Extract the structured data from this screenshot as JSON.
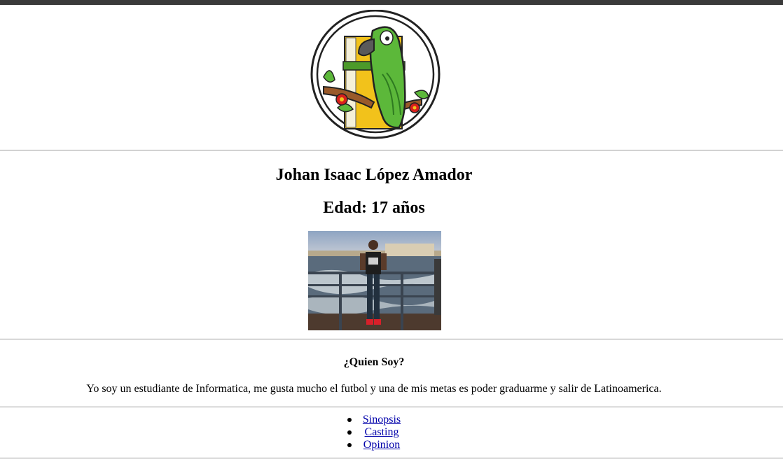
{
  "profile": {
    "name": "Johan Isaac López Amador",
    "age": "Edad: 17 años"
  },
  "about": {
    "title": "¿Quien Soy?",
    "text": "Yo soy un estudiante de Informatica, me gusta mucho el futbol y una de mis metas es poder graduarme y salir de Latinoamerica."
  },
  "nav": {
    "items": [
      {
        "label": "Sinopsis"
      },
      {
        "label": "Casting"
      },
      {
        "label": "Opinion"
      }
    ]
  },
  "colors": {
    "link": "#0000aa",
    "rule": "#9a9a9a",
    "parrot_green": "#5cb83a",
    "book_yellow": "#f2c21b"
  }
}
